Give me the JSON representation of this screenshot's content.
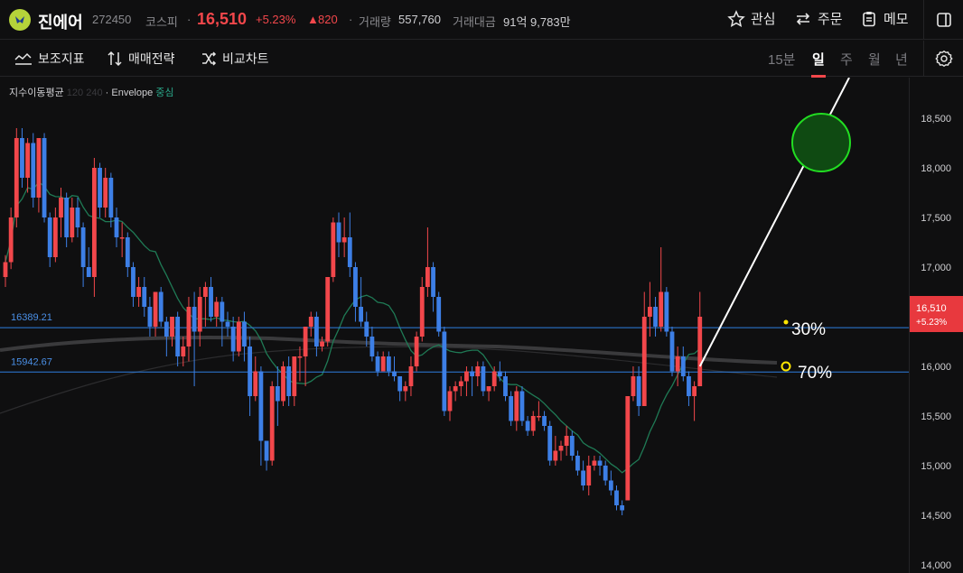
{
  "header": {
    "name": "진에어",
    "code": "272450",
    "market": "코스피",
    "price": "16,510",
    "change_pct": "+5.23%",
    "change_abs": "820",
    "volume_label": "거래량",
    "volume": "557,760",
    "amount_label": "거래대금",
    "amount": "91억 9,783만",
    "watch_label": "관심",
    "order_label": "주문",
    "memo_label": "메모"
  },
  "toolbar": {
    "indicator_label": "보조지표",
    "strategy_label": "매매전략",
    "compare_label": "비교차트",
    "periods": [
      "15분",
      "일",
      "주",
      "월",
      "년"
    ],
    "active_period": "일"
  },
  "legend": {
    "ma_label": "지수이동평균",
    "ma_periods": "120 240",
    "envelope_label": "Envelope",
    "envelope_state": "중심"
  },
  "colors": {
    "up": "#f2474b",
    "down": "#3d7fe6",
    "accent_line": "#2f7fe0",
    "ma": "#1f7a55"
  },
  "chart_data": {
    "type": "candlestick",
    "y_ticks": [
      "18,500",
      "18,000",
      "17,500",
      "17,000",
      "16,500",
      "16,000",
      "15,500",
      "15,000",
      "14,500",
      "14,000"
    ],
    "ylim": [
      14000,
      18800
    ],
    "current_price_label": "16,510",
    "current_change_label": "+5.23%",
    "horizontal_lines": [
      {
        "value": 16389.21,
        "label": "16389.21"
      },
      {
        "value": 15942.67,
        "label": "15942.67"
      }
    ],
    "annotations": [
      "30%",
      "70%"
    ],
    "candles": [
      [
        16900,
        17120,
        16800,
        17050
      ],
      [
        17050,
        17600,
        16980,
        17500
      ],
      [
        17500,
        18400,
        17400,
        18300
      ],
      [
        18300,
        18400,
        17800,
        17900
      ],
      [
        17900,
        18300,
        17750,
        18250
      ],
      [
        18250,
        18350,
        17600,
        17700
      ],
      [
        17700,
        18200,
        17550,
        18300
      ],
      [
        18300,
        18350,
        17450,
        17500
      ],
      [
        17500,
        17550,
        17000,
        17100
      ],
      [
        17100,
        17600,
        17050,
        17500
      ],
      [
        17500,
        17800,
        17300,
        17700
      ],
      [
        17700,
        17750,
        17200,
        17300
      ],
      [
        17300,
        17700,
        17250,
        17600
      ],
      [
        17600,
        17700,
        17300,
        17400
      ],
      [
        17400,
        17450,
        16800,
        17000
      ],
      [
        17000,
        17200,
        16900,
        16900
      ],
      [
        16900,
        18100,
        16700,
        18000
      ],
      [
        18000,
        18050,
        17500,
        17600
      ],
      [
        17600,
        18000,
        17500,
        17900
      ],
      [
        17900,
        17950,
        17400,
        17500
      ],
      [
        17500,
        17600,
        17200,
        17300
      ],
      [
        17300,
        17450,
        17100,
        17300
      ],
      [
        17300,
        17350,
        16900,
        17000
      ],
      [
        17000,
        17050,
        16600,
        16700
      ],
      [
        16700,
        16900,
        16600,
        16800
      ],
      [
        16800,
        16900,
        16500,
        16600
      ],
      [
        16600,
        16700,
        16300,
        16400
      ],
      [
        16400,
        16750,
        16300,
        16750
      ],
      [
        16750,
        16800,
        16400,
        16450
      ],
      [
        16450,
        16500,
        16100,
        16300
      ],
      [
        16300,
        16500,
        16200,
        16500
      ],
      [
        16500,
        16550,
        16000,
        16100
      ],
      [
        16100,
        16300,
        16000,
        16200
      ],
      [
        16200,
        16700,
        16050,
        16600
      ],
      [
        16600,
        16750,
        15800,
        16350
      ],
      [
        16350,
        16800,
        16200,
        16700
      ],
      [
        16700,
        16850,
        16400,
        16800
      ],
      [
        16800,
        16900,
        16450,
        16500
      ],
      [
        16500,
        16700,
        16400,
        16650
      ],
      [
        16650,
        16700,
        16200,
        16450
      ],
      [
        16450,
        16550,
        16300,
        16400
      ],
      [
        16400,
        16500,
        16050,
        16150
      ],
      [
        16150,
        16500,
        16100,
        16450
      ],
      [
        16450,
        16550,
        16050,
        16200
      ],
      [
        16200,
        16300,
        15500,
        15700
      ],
      [
        15700,
        16100,
        15650,
        15950
      ],
      [
        15950,
        16000,
        15000,
        15250
      ],
      [
        15250,
        15250,
        14950,
        15050
      ],
      [
        15050,
        15850,
        15000,
        15800
      ],
      [
        15800,
        16000,
        15400,
        15650
      ],
      [
        15650,
        16050,
        15600,
        16000
      ],
      [
        16000,
        16100,
        15600,
        15700
      ],
      [
        15700,
        16100,
        15600,
        16100
      ],
      [
        16100,
        16200,
        15850,
        16100
      ],
      [
        16100,
        16400,
        15800,
        16400
      ],
      [
        16400,
        16550,
        16300,
        16500
      ],
      [
        16500,
        16550,
        16100,
        16200
      ],
      [
        16200,
        16300,
        16150,
        16250
      ],
      [
        16250,
        16900,
        16200,
        16900
      ],
      [
        16900,
        17500,
        16850,
        17450
      ],
      [
        17450,
        17550,
        17100,
        17250
      ],
      [
        17250,
        17500,
        17100,
        17300
      ],
      [
        17300,
        17550,
        16900,
        17000
      ],
      [
        17000,
        17050,
        16450,
        16600
      ],
      [
        16600,
        16900,
        16400,
        16450
      ],
      [
        16450,
        16550,
        16200,
        16300
      ],
      [
        16300,
        16400,
        16050,
        16100
      ],
      [
        16100,
        16150,
        15900,
        15950
      ],
      [
        15950,
        16150,
        15950,
        16100
      ],
      [
        16100,
        16150,
        15900,
        15950
      ],
      [
        15950,
        16100,
        15850,
        15900
      ],
      [
        15900,
        15900,
        15650,
        15750
      ],
      [
        15750,
        15850,
        15650,
        15800
      ],
      [
        15800,
        16100,
        15700,
        16000
      ],
      [
        16000,
        16350,
        15950,
        16300
      ],
      [
        16300,
        16900,
        16250,
        16800
      ],
      [
        16800,
        17400,
        16700,
        17000
      ],
      [
        17000,
        17050,
        16550,
        16700
      ],
      [
        16700,
        16750,
        16300,
        16350
      ],
      [
        16350,
        16400,
        15500,
        15550
      ],
      [
        15550,
        15800,
        15450,
        15750
      ],
      [
        15750,
        15850,
        15650,
        15800
      ],
      [
        15800,
        15900,
        15700,
        15850
      ],
      [
        15850,
        16000,
        15700,
        15950
      ],
      [
        15950,
        16000,
        15700,
        15900
      ],
      [
        15900,
        16050,
        15800,
        16000
      ],
      [
        16000,
        16050,
        15700,
        15750
      ],
      [
        15750,
        15800,
        15650,
        15800
      ],
      [
        15800,
        16000,
        15750,
        15950
      ],
      [
        15950,
        16050,
        15850,
        15900
      ],
      [
        15900,
        15950,
        15650,
        15700
      ],
      [
        15700,
        15750,
        15400,
        15450
      ],
      [
        15450,
        15800,
        15350,
        15750
      ],
      [
        15750,
        15800,
        15400,
        15450
      ],
      [
        15450,
        15500,
        15300,
        15350
      ],
      [
        15350,
        15550,
        15300,
        15500
      ],
      [
        15500,
        15650,
        15450,
        15500
      ],
      [
        15500,
        15550,
        15350,
        15400
      ],
      [
        15400,
        15450,
        15000,
        15050
      ],
      [
        15050,
        15300,
        15000,
        15150
      ],
      [
        15150,
        15250,
        15050,
        15200
      ],
      [
        15200,
        15400,
        15100,
        15300
      ],
      [
        15300,
        15350,
        15050,
        15100
      ],
      [
        15100,
        15150,
        14900,
        14950
      ],
      [
        14950,
        15050,
        14750,
        14800
      ],
      [
        14800,
        15100,
        14700,
        15000
      ],
      [
        15000,
        15100,
        14950,
        15050
      ],
      [
        15050,
        15100,
        14900,
        15000
      ],
      [
        15000,
        15050,
        14800,
        14850
      ],
      [
        14850,
        14950,
        14700,
        14750
      ],
      [
        14750,
        14800,
        14550,
        14600
      ],
      [
        14600,
        14650,
        14500,
        14550
      ],
      [
        14650,
        15700,
        14650,
        15700
      ],
      [
        15700,
        16000,
        15650,
        15900
      ],
      [
        15900,
        16000,
        15500,
        15600
      ],
      [
        15600,
        16750,
        15600,
        16500
      ],
      [
        16500,
        16850,
        16300,
        16600
      ],
      [
        16600,
        16700,
        16300,
        16400
      ],
      [
        16400,
        17200,
        16350,
        16750
      ],
      [
        16750,
        16800,
        16300,
        16350
      ],
      [
        16350,
        16400,
        15900,
        15950
      ],
      [
        15950,
        16200,
        15800,
        16100
      ],
      [
        16100,
        16200,
        15850,
        15900
      ],
      [
        15900,
        15950,
        15600,
        15700
      ],
      [
        15700,
        15850,
        15450,
        15800
      ],
      [
        15800,
        16750,
        15800,
        16500
      ]
    ]
  }
}
